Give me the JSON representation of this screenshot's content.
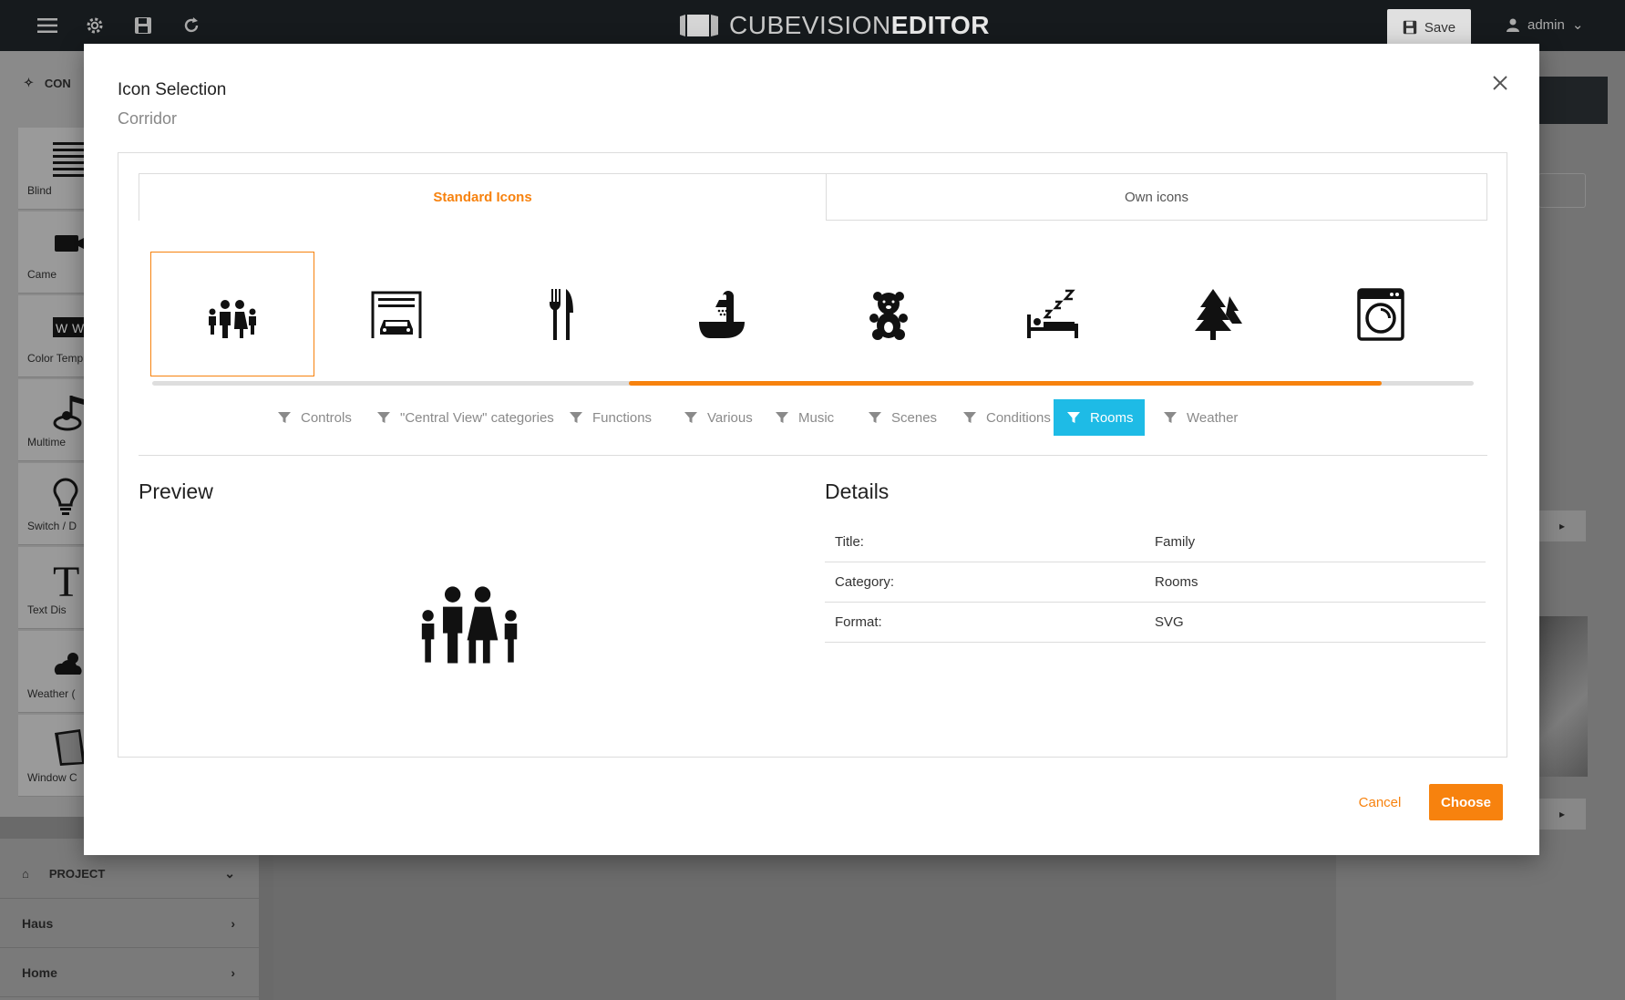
{
  "app": {
    "brand_light": "CUBEVISION",
    "brand_bold": "EDITOR",
    "save_label": "Save",
    "user_name": "admin"
  },
  "sidebar": {
    "header": "CON",
    "tools": [
      {
        "label": "Blind",
        "icon": "blinds-icon"
      },
      {
        "label": "Came",
        "icon": "camera-icon"
      },
      {
        "label": "Color Temp",
        "icon": "color-temperature-icon"
      },
      {
        "label": "Multime",
        "icon": "multimedia-icon"
      },
      {
        "label": "Switch / D",
        "icon": "lightbulb-icon"
      },
      {
        "label": "Text Dis",
        "icon": "text-icon"
      },
      {
        "label": "Weather (",
        "icon": "weather-icon"
      },
      {
        "label": "Window C",
        "icon": "window-icon"
      }
    ]
  },
  "bottom_nav": {
    "project_label": "PROJECT",
    "items": [
      "Haus",
      "Home"
    ]
  },
  "modal": {
    "title": "Icon Selection",
    "subtitle": "Corridor",
    "tabs": [
      "Standard Icons",
      "Own icons"
    ],
    "icons": [
      {
        "name": "family-icon",
        "selected": true
      },
      {
        "name": "garage-icon",
        "selected": false
      },
      {
        "name": "fork-knife-icon",
        "selected": false
      },
      {
        "name": "bathtub-shower-icon",
        "selected": false
      },
      {
        "name": "teddy-bear-icon",
        "selected": false
      },
      {
        "name": "sleeping-bed-icon",
        "selected": false
      },
      {
        "name": "trees-icon",
        "selected": false
      },
      {
        "name": "washing-machine-icon",
        "selected": false
      }
    ],
    "scroll_position_fraction": 0.57,
    "filters": [
      {
        "label": "Controls",
        "active": false
      },
      {
        "label": "\"Central View\" categories",
        "active": false
      },
      {
        "label": "Functions",
        "active": false
      },
      {
        "label": "Various",
        "active": false
      },
      {
        "label": "Music",
        "active": false
      },
      {
        "label": "Scenes",
        "active": false
      },
      {
        "label": "Conditions",
        "active": false
      },
      {
        "label": "Rooms",
        "active": true
      },
      {
        "label": "Weather",
        "active": false
      }
    ],
    "preview_title": "Preview",
    "details_title": "Details",
    "details": [
      {
        "key": "Title:",
        "value": "Family"
      },
      {
        "key": "Category:",
        "value": "Rooms"
      },
      {
        "key": "Format:",
        "value": "SVG"
      }
    ],
    "cancel_label": "Cancel",
    "choose_label": "Choose"
  },
  "colors": {
    "accent_orange": "#f7820e",
    "filter_active_blue": "#1ebbe6",
    "topbar": "#161a1d"
  }
}
